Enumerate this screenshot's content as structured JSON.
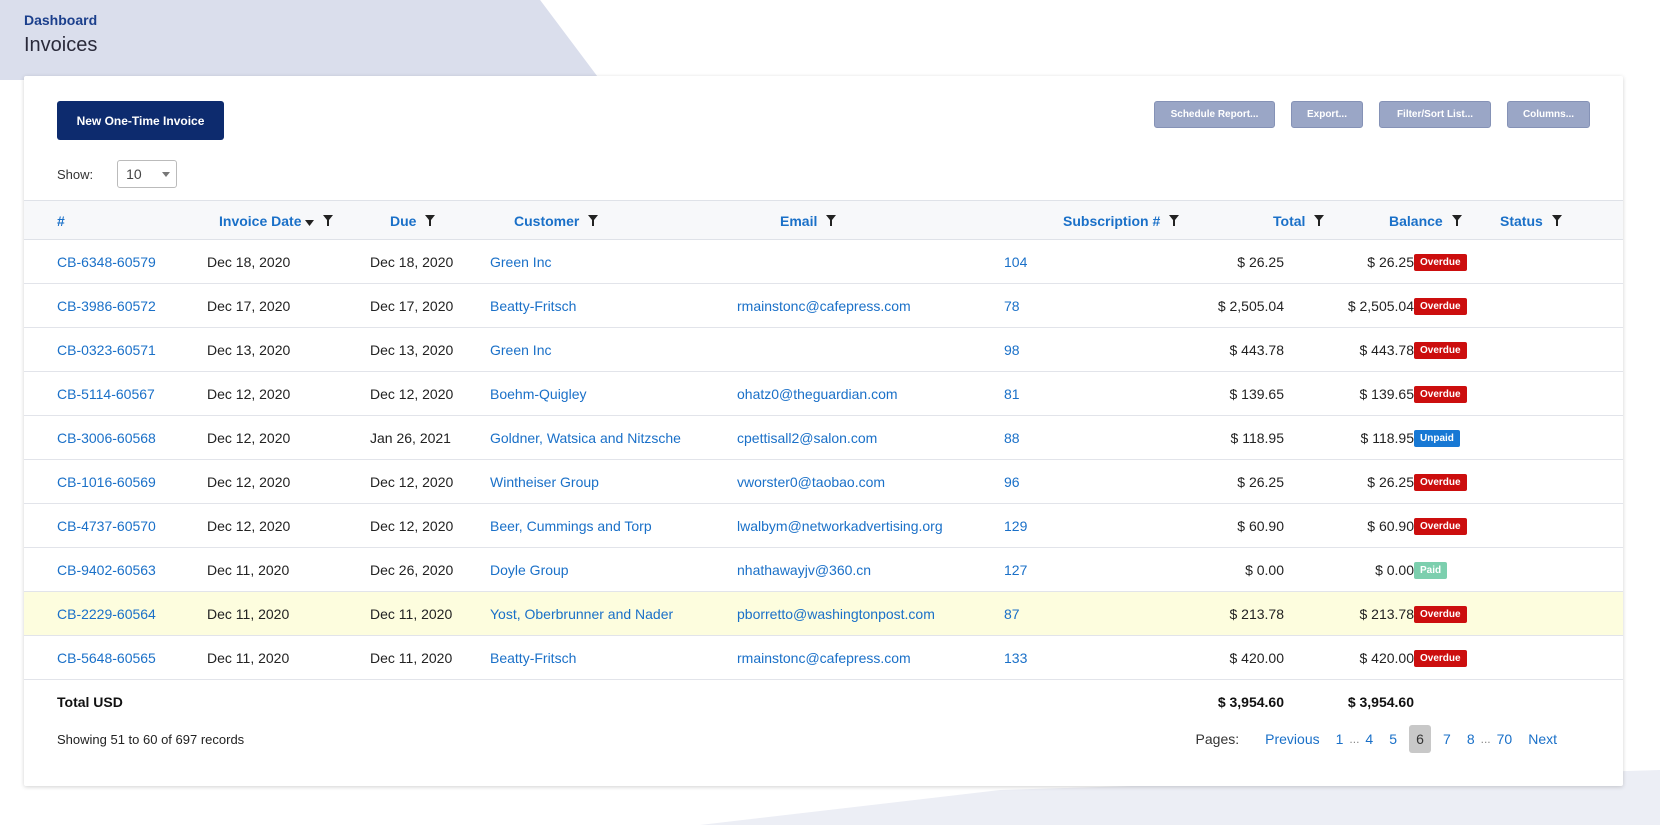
{
  "breadcrumb": "Dashboard",
  "page_title": "Invoices",
  "toolbar": {
    "new_invoice": "New One-Time Invoice",
    "schedule_report": "Schedule Report...",
    "export": "Export...",
    "filter_sort": "Filter/Sort List...",
    "columns": "Columns..."
  },
  "show": {
    "label": "Show:",
    "value": "10"
  },
  "columns": {
    "num": "#",
    "invoice_date": "Invoice Date",
    "due": "Due",
    "customer": "Customer",
    "email": "Email",
    "subscription": "Subscription #",
    "total": "Total",
    "balance": "Balance",
    "status": "Status"
  },
  "rows": [
    {
      "num": "CB-6348-60579",
      "date": "Dec 18, 2020",
      "due": "Dec 18, 2020",
      "customer": "Green Inc",
      "email": "",
      "sub": "104",
      "total": "$ 26.25",
      "balance": "$ 26.25",
      "status": "Overdue"
    },
    {
      "num": "CB-3986-60572",
      "date": "Dec 17, 2020",
      "due": "Dec 17, 2020",
      "customer": "Beatty-Fritsch",
      "email": "rmainstonc@cafepress.com",
      "sub": "78",
      "total": "$ 2,505.04",
      "balance": "$ 2,505.04",
      "status": "Overdue"
    },
    {
      "num": "CB-0323-60571",
      "date": "Dec 13, 2020",
      "due": "Dec 13, 2020",
      "customer": "Green Inc",
      "email": "",
      "sub": "98",
      "total": "$ 443.78",
      "balance": "$ 443.78",
      "status": "Overdue"
    },
    {
      "num": "CB-5114-60567",
      "date": "Dec 12, 2020",
      "due": "Dec 12, 2020",
      "customer": "Boehm-Quigley",
      "email": "ohatz0@theguardian.com",
      "sub": "81",
      "total": "$ 139.65",
      "balance": "$ 139.65",
      "status": "Overdue"
    },
    {
      "num": "CB-3006-60568",
      "date": "Dec 12, 2020",
      "due": "Jan 26, 2021",
      "customer": "Goldner, Watsica and Nitzsche",
      "email": "cpettisall2@salon.com",
      "sub": "88",
      "total": "$ 118.95",
      "balance": "$ 118.95",
      "status": "Unpaid"
    },
    {
      "num": "CB-1016-60569",
      "date": "Dec 12, 2020",
      "due": "Dec 12, 2020",
      "customer": "Wintheiser Group",
      "email": "vworster0@taobao.com",
      "sub": "96",
      "total": "$ 26.25",
      "balance": "$ 26.25",
      "status": "Overdue"
    },
    {
      "num": "CB-4737-60570",
      "date": "Dec 12, 2020",
      "due": "Dec 12, 2020",
      "customer": "Beer, Cummings and Torp",
      "email": "lwalbym@networkadvertising.org",
      "sub": "129",
      "total": "$ 60.90",
      "balance": "$ 60.90",
      "status": "Overdue"
    },
    {
      "num": "CB-9402-60563",
      "date": "Dec 11, 2020",
      "due": "Dec 26, 2020",
      "customer": "Doyle Group",
      "email": "nhathawayjv@360.cn",
      "sub": "127",
      "total": "$ 0.00",
      "balance": "$ 0.00",
      "status": "Paid"
    },
    {
      "num": "CB-2229-60564",
      "date": "Dec 11, 2020",
      "due": "Dec 11, 2020",
      "customer": "Yost, Oberbrunner and Nader",
      "email": "pborretto@washingtonpost.com",
      "sub": "87",
      "total": "$ 213.78",
      "balance": "$ 213.78",
      "status": "Overdue",
      "highlight": true
    },
    {
      "num": "CB-5648-60565",
      "date": "Dec 11, 2020",
      "due": "Dec 11, 2020",
      "customer": "Beatty-Fritsch",
      "email": "rmainstonc@cafepress.com",
      "sub": "133",
      "total": "$ 420.00",
      "balance": "$ 420.00",
      "status": "Overdue"
    }
  ],
  "totals": {
    "label": "Total USD",
    "total": "$ 3,954.60",
    "balance": "$ 3,954.60"
  },
  "records_text": "Showing 51 to 60 of 697 records",
  "pagination": {
    "label": "Pages:",
    "previous": "Previous",
    "next": "Next",
    "pages": [
      "1",
      "...",
      "4",
      "5",
      "6",
      "7",
      "8",
      "...",
      "70"
    ],
    "current": "6"
  },
  "colors": {
    "primary": "#0d2b6e",
    "link": "#1a70c8",
    "overdue": "#cc0e0e",
    "unpaid": "#1778d4",
    "paid": "#7ccfae",
    "highlight_row": "#fdfdde"
  }
}
